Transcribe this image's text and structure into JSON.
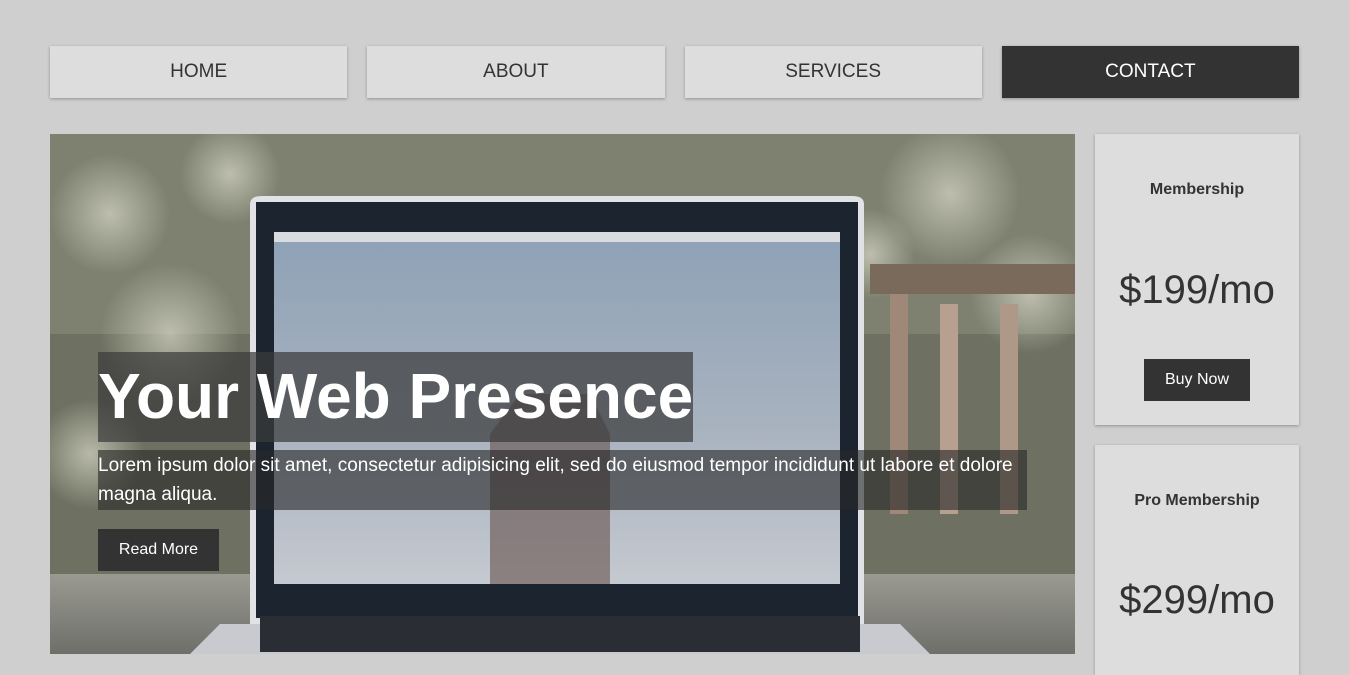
{
  "nav": {
    "items": [
      {
        "label": "HOME"
      },
      {
        "label": "ABOUT"
      },
      {
        "label": "SERVICES"
      },
      {
        "label": "CONTACT"
      }
    ],
    "active_index": 3
  },
  "hero": {
    "title": "Your Web Presence",
    "text": "Lorem ipsum dolor sit amet, consectetur adipisicing elit, sed do eiusmod tempor incididunt ut labore et dolore magna aliqua.",
    "button_label": "Read More",
    "image_subject": "laptop-on-table-photo"
  },
  "sidebar": {
    "cards": [
      {
        "title": "Membership",
        "price": "$199/mo",
        "button_label": "Buy Now"
      },
      {
        "title": "Pro Membership",
        "price": "$299/mo"
      }
    ]
  },
  "colors": {
    "page_bg": "#cfcfcf",
    "nav_bg": "#dddddd",
    "accent_dark": "#333333",
    "text_light": "#ffffff"
  }
}
